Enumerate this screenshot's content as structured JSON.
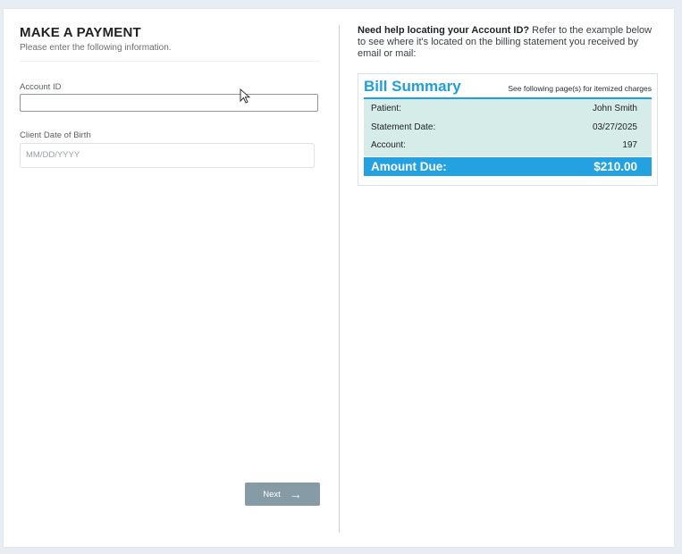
{
  "form": {
    "title": "MAKE A PAYMENT",
    "subtitle": "Please enter the following information.",
    "account_id": {
      "label": "Account ID",
      "value": "",
      "placeholder": ""
    },
    "dob": {
      "label": "Client Date of Birth",
      "placeholder": "MM/DD/YYYY"
    },
    "next_label": "Next",
    "next_icon": "arrow-right-icon"
  },
  "help": {
    "lead": "Need help locating your Account ID?",
    "text": " Refer to the example below to see where it's located on the billing statement you received by email or mail:"
  },
  "bill": {
    "title": "Bill Summary",
    "note": "See following page(s) for itemized charges",
    "rows": [
      {
        "label": "Patient:",
        "value": "John Smith"
      },
      {
        "label": "Statement Date:",
        "value": "03/27/2025"
      },
      {
        "label": "Account:",
        "value": "197"
      }
    ],
    "amount_label": "Amount Due:",
    "amount_value": "$210.00",
    "accent_color": "#1f9fd9",
    "panel_color": "#d6ece8"
  }
}
